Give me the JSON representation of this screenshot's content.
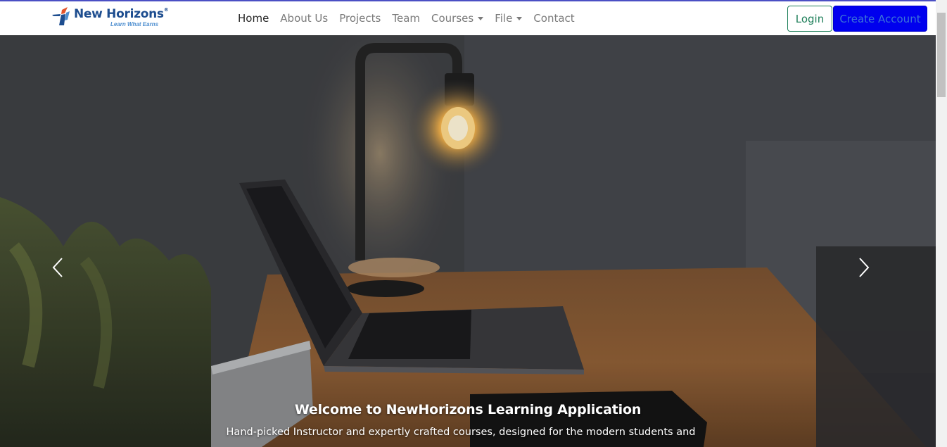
{
  "brand": {
    "name": "New Horizons",
    "reg": "®",
    "tagline": "Learn What Earns"
  },
  "nav": {
    "home": "Home",
    "about": "About Us",
    "projects": "Projects",
    "team": "Team",
    "courses": "Courses",
    "file": "File",
    "contact": "Contact"
  },
  "auth": {
    "login": "Login",
    "create": "Create Account"
  },
  "hero": {
    "title": "Welcome to NewHorizons Learning Application",
    "subtitle": "Hand-picked Instructor and expertly crafted courses, designed for the modern students and"
  },
  "colors": {
    "accent": "#0000ee",
    "login_border": "#1e7f5a",
    "brand_blue": "#1d4d8f"
  },
  "icons": {
    "prev": "chevron-left-icon",
    "next": "chevron-right-icon",
    "caret": "caret-down-icon"
  }
}
